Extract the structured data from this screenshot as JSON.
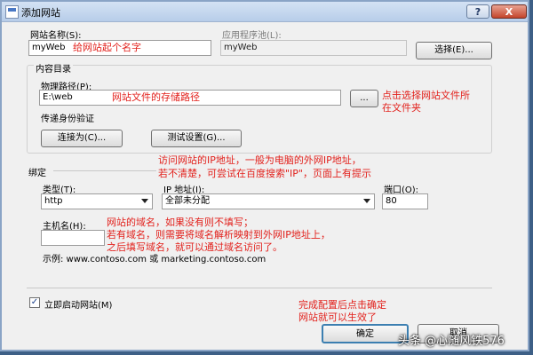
{
  "window": {
    "title": "添加网站",
    "help_label": "?",
    "close_label": "X",
    "icon": "website-icon"
  },
  "site": {
    "name_label": "网站名称(S):",
    "name_value": "myWeb",
    "name_annotation": "给网站起个名字",
    "pool_label": "应用程序池(L):",
    "pool_value": "myWeb",
    "select_button": "选择(E)..."
  },
  "content": {
    "group_label": "内容目录",
    "path_label": "物理路径(P):",
    "path_value": "E:\\web",
    "path_annotation": "网站文件的存储路径",
    "browse_button": "...",
    "browse_annotation": [
      "点击选择网站文件所",
      "在文件夹"
    ],
    "auth_label": "传递身份验证",
    "connect_as_button": "连接为(C)...",
    "test_settings_button": "测试设置(G)..."
  },
  "binding": {
    "group_label": "绑定",
    "ip_annotation": [
      "访问网站的IP地址，一般为电脑的外网IP地址，",
      "若不清楚，可尝试在百度搜索\"IP\"，页面上有提示"
    ],
    "type_label": "类型(T):",
    "type_value": "http",
    "ip_label": "IP 地址(I):",
    "ip_value": "全部未分配",
    "port_label": "端口(O):",
    "port_value": "80",
    "host_label": "主机名(H):",
    "host_value": "",
    "host_annotation": [
      "网站的域名，如果没有则不填写；",
      "若有域名，则需要将域名解析映射到外网IP地址上，",
      "之后填写域名，就可以通过域名访问了。"
    ],
    "example_text": "示例: www.contoso.com 或 marketing.contoso.com"
  },
  "footer": {
    "autostart_label": "立即启动网站(M)",
    "autostart_checked": true,
    "check_mark": "✓",
    "ok_button": "确定",
    "cancel_button": "取消",
    "confirm_annotation": [
      "完成配置后点击确定",
      "网站就可以生效了"
    ]
  },
  "watermark": "头条 @心随风铁576",
  "colors": {
    "annotation": "#e2211c",
    "frame": "#8aa4c6",
    "background": "#3d5f86"
  }
}
